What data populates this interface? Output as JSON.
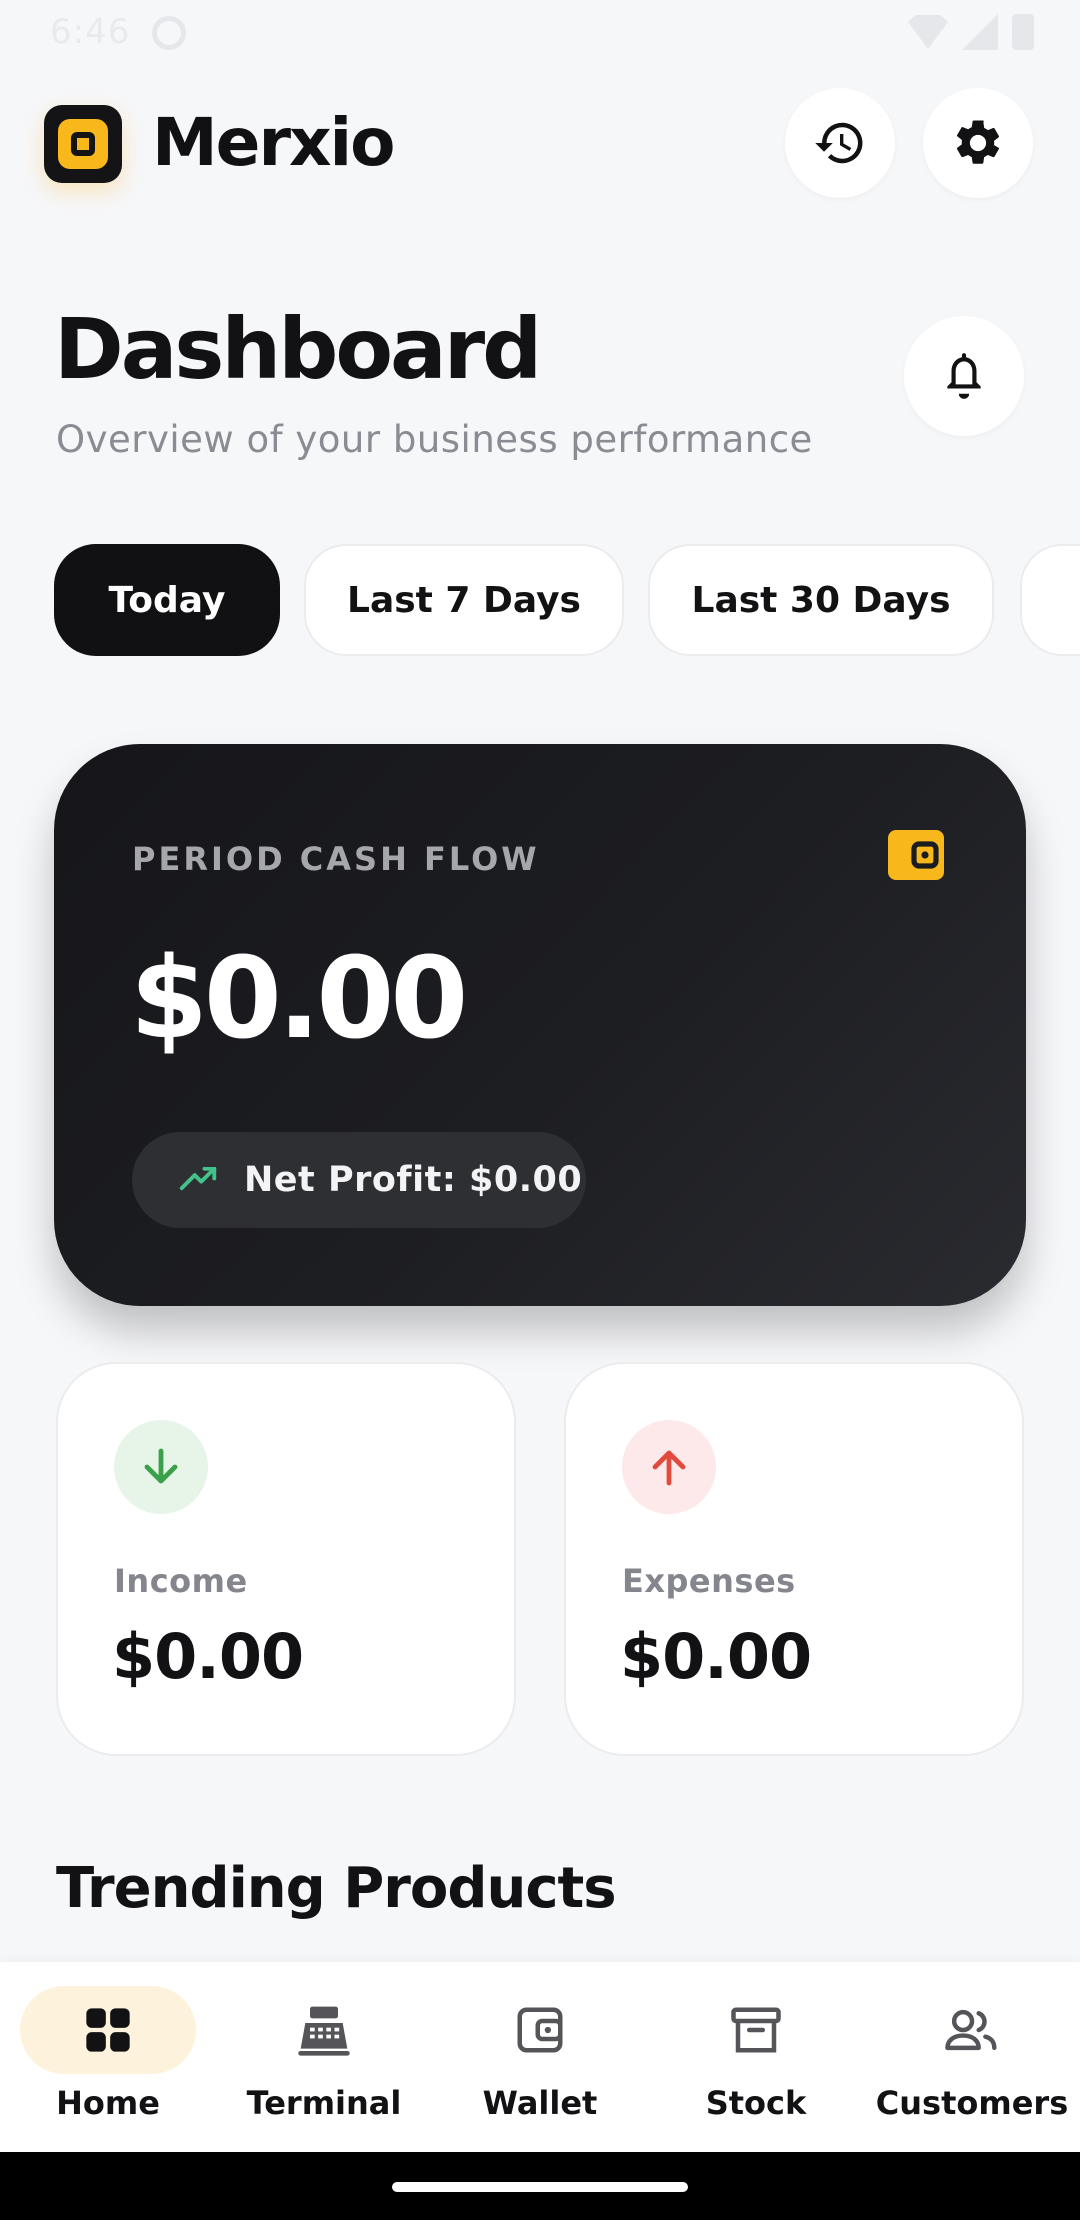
{
  "status_bar": {
    "time": "6:46"
  },
  "header": {
    "app_name": "Merxio"
  },
  "page": {
    "title": "Dashboard",
    "subtitle": "Overview of your business performance"
  },
  "filters": {
    "selected": "Today",
    "options": [
      "Today",
      "Last 7 Days",
      "Last 30 Days"
    ]
  },
  "cash_flow": {
    "label": "PERIOD CASH FLOW",
    "amount": "$0.00",
    "net_profit": "Net Profit: $0.00"
  },
  "stats": {
    "income": {
      "label": "Income",
      "value": "$0.00"
    },
    "expenses": {
      "label": "Expenses",
      "value": "$0.00"
    }
  },
  "trending": {
    "title": "Trending Products"
  },
  "bottom_nav": {
    "active": "Home",
    "items": [
      {
        "label": "Home",
        "icon": "grid-icon"
      },
      {
        "label": "Terminal",
        "icon": "cash-register-icon"
      },
      {
        "label": "Wallet",
        "icon": "wallet-icon"
      },
      {
        "label": "Stock",
        "icon": "archive-box-icon"
      },
      {
        "label": "Customers",
        "icon": "people-icon"
      }
    ]
  },
  "colors": {
    "accent": "#f8b81c",
    "dark": "#111113",
    "income": "#3aa14a",
    "expense": "#e24a3b",
    "profit_trend": "#43c38a"
  }
}
